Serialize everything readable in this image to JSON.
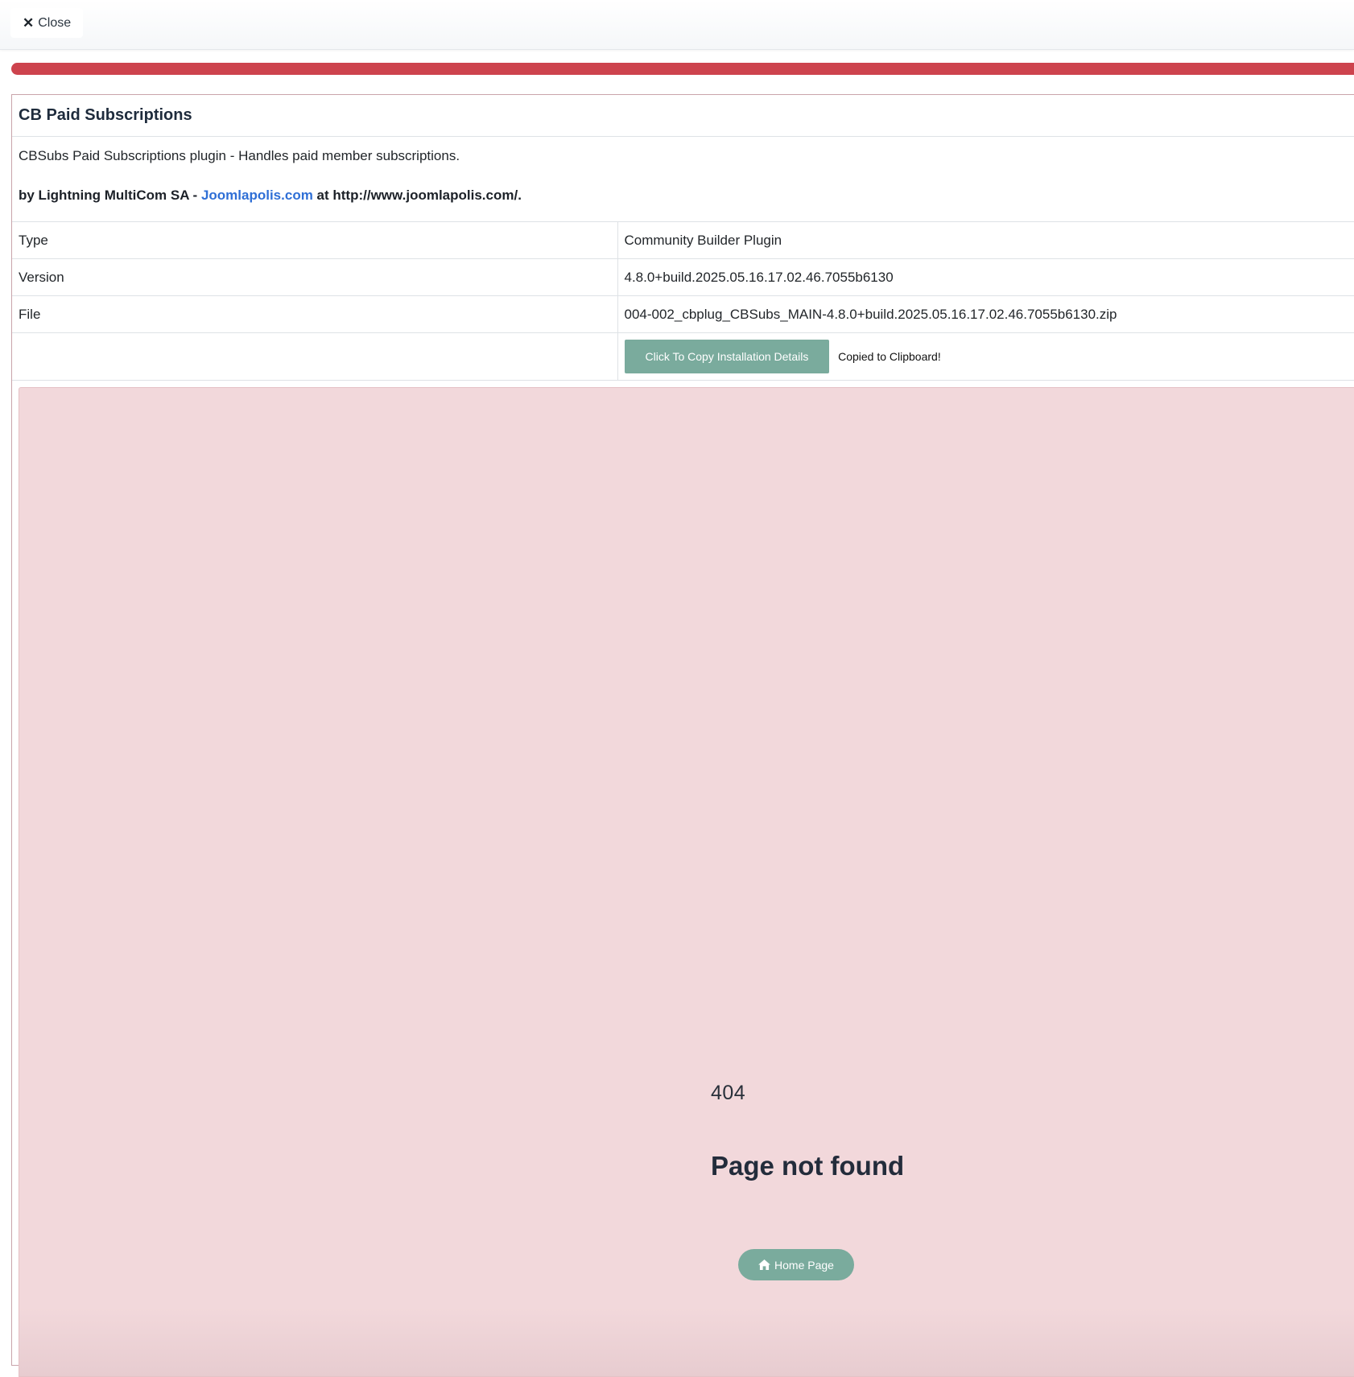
{
  "topbar": {
    "close_label": "Close",
    "close_icon": "close-icon"
  },
  "progress": {
    "value_percent": 100,
    "color": "#cd434d"
  },
  "plugin": {
    "title": "CB Paid Subscriptions",
    "description": "CBSubs Paid Subscriptions plugin - Handles paid member subscriptions.",
    "author_prefix": "by Lightning MultiCom SA - ",
    "author_link": "Joomlapolis.com",
    "author_suffix": " at http://www.joomlapolis.com/."
  },
  "details": {
    "type_label": "Type",
    "type_value": "Community Builder Plugin",
    "version_label": "Version",
    "version_value": "4.8.0+build.2025.05.16.17.02.46.7055b6130",
    "file_label": "File",
    "file_value": "004-002_cbplug_CBSubs_MAIN-4.8.0+build.2025.05.16.17.02.46.7055b6130.zip",
    "copy_button_label": "Click To Copy Installation Details",
    "copied_message": "Copied to Clipboard!"
  },
  "error_page": {
    "code": "404",
    "message": "Page not found",
    "home_button_label": "Home Page",
    "home_icon": "home-icon"
  },
  "colors": {
    "accent_green": "#7aab9d",
    "error_background": "#f2d8db",
    "link_blue": "#2f6fd6"
  }
}
